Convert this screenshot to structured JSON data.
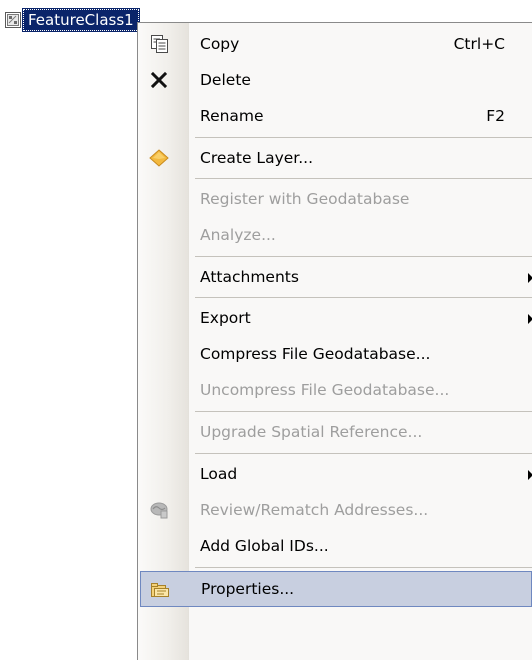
{
  "tree_node": {
    "icon": "feature-class-icon",
    "label": "FeatureClass1"
  },
  "context_menu": {
    "items": [
      {
        "label": "Copy",
        "shortcut": "Ctrl+C",
        "icon": "copy-icon",
        "enabled": true
      },
      {
        "label": "Delete",
        "icon": "delete-icon",
        "enabled": true
      },
      {
        "label": "Rename",
        "shortcut": "F2",
        "enabled": true
      },
      {
        "label": "Create Layer...",
        "icon": "create-layer-icon",
        "enabled": true
      },
      {
        "label": "Register with Geodatabase",
        "enabled": false
      },
      {
        "label": "Analyze...",
        "enabled": false
      },
      {
        "label": "Attachments",
        "submenu": true,
        "enabled": true
      },
      {
        "label": "Export",
        "submenu": true,
        "enabled": true
      },
      {
        "label": "Compress File Geodatabase...",
        "enabled": true
      },
      {
        "label": "Uncompress File Geodatabase...",
        "enabled": false
      },
      {
        "label": "Upgrade Spatial Reference...",
        "enabled": false
      },
      {
        "label": "Load",
        "submenu": true,
        "enabled": true
      },
      {
        "label": "Review/Rematch Addresses...",
        "icon": "review-rematch-icon",
        "enabled": false
      },
      {
        "label": "Add Global IDs...",
        "enabled": true
      },
      {
        "label": "Properties...",
        "icon": "properties-icon",
        "enabled": true,
        "selected": true
      }
    ]
  },
  "colors": {
    "selection_highlight": "#c8cfe0",
    "selection_border": "#6f88c0",
    "tree_selection": "#0a246a",
    "disabled_text": "#9e9e9e",
    "create_layer_diamond": "#f3b93f"
  }
}
